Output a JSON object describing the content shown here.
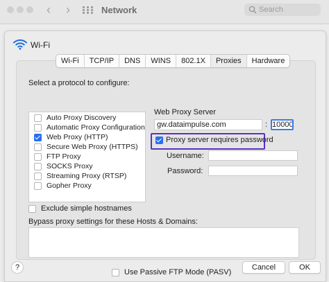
{
  "window": {
    "title": "Network"
  },
  "search": {
    "placeholder": "Search"
  },
  "interface": {
    "name": "Wi-Fi"
  },
  "tabs": [
    {
      "label": "Wi-Fi",
      "active": false
    },
    {
      "label": "TCP/IP",
      "active": false
    },
    {
      "label": "DNS",
      "active": false
    },
    {
      "label": "WINS",
      "active": false
    },
    {
      "label": "802.1X",
      "active": false
    },
    {
      "label": "Proxies",
      "active": true
    },
    {
      "label": "Hardware",
      "active": false
    }
  ],
  "protocols": {
    "heading": "Select a protocol to configure:",
    "items": [
      {
        "label": "Auto Proxy Discovery",
        "checked": false
      },
      {
        "label": "Automatic Proxy Configuration",
        "checked": false
      },
      {
        "label": "Web Proxy (HTTP)",
        "checked": true
      },
      {
        "label": "Secure Web Proxy (HTTPS)",
        "checked": false
      },
      {
        "label": "FTP Proxy",
        "checked": false
      },
      {
        "label": "SOCKS Proxy",
        "checked": false
      },
      {
        "label": "Streaming Proxy (RTSP)",
        "checked": false
      },
      {
        "label": "Gopher Proxy",
        "checked": false
      }
    ]
  },
  "proxy": {
    "heading": "Web Proxy Server",
    "server": "gw.dataimpulse.com",
    "separator": ":",
    "port": "10000",
    "requires_password_label": "Proxy server requires password",
    "requires_password": true,
    "username_label": "Username:",
    "username": "",
    "password_label": "Password:",
    "password": ""
  },
  "exclude_simple_hostnames": {
    "label": "Exclude simple hostnames",
    "checked": false
  },
  "bypass": {
    "label": "Bypass proxy settings for these Hosts & Domains:",
    "value": ""
  },
  "passive_ftp": {
    "label": "Use Passive FTP Mode (PASV)",
    "checked": false
  },
  "footer": {
    "help": "?",
    "cancel": "Cancel",
    "ok": "OK"
  },
  "colors": {
    "accent": "#2a6ef0",
    "highlight_border": "#5b31c4",
    "focus_border": "#3b7be8"
  }
}
